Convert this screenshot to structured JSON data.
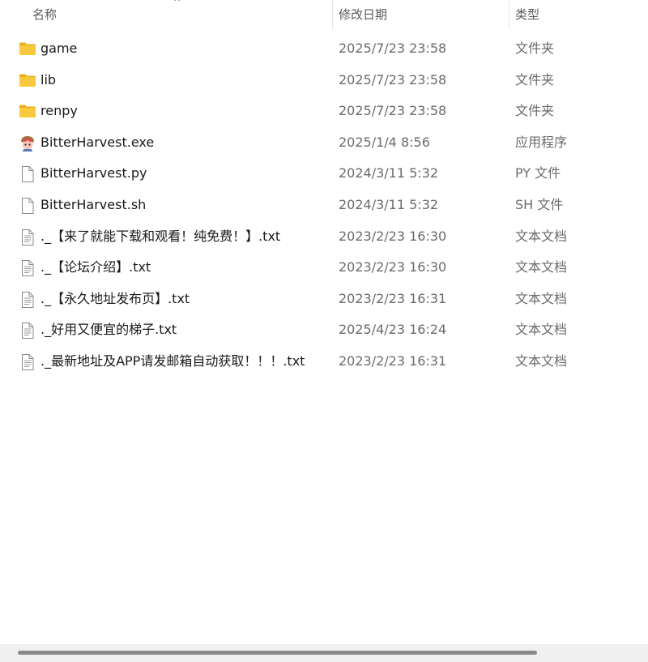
{
  "columns": {
    "name": "名称",
    "date": "修改日期",
    "type": "类型"
  },
  "sort_indicator": "^",
  "files": [
    {
      "name": "game",
      "date": "2025/7/23 23:58",
      "type": "文件夹",
      "icon": "folder-icon"
    },
    {
      "name": "lib",
      "date": "2025/7/23 23:58",
      "type": "文件夹",
      "icon": "folder-icon"
    },
    {
      "name": "renpy",
      "date": "2025/7/23 23:58",
      "type": "文件夹",
      "icon": "folder-icon"
    },
    {
      "name": "BitterHarvest.exe",
      "date": "2025/1/4 8:56",
      "type": "应用程序",
      "icon": "app-icon"
    },
    {
      "name": "BitterHarvest.py",
      "date": "2024/3/11 5:32",
      "type": "PY 文件",
      "icon": "blank-file-icon"
    },
    {
      "name": "BitterHarvest.sh",
      "date": "2024/3/11 5:32",
      "type": "SH 文件",
      "icon": "blank-file-icon"
    },
    {
      "name": "._【来了就能下载和观看！纯免费！】.txt",
      "date": "2023/2/23 16:30",
      "type": "文本文档",
      "icon": "text-file-icon"
    },
    {
      "name": "._【论坛介绍】.txt",
      "date": "2023/2/23 16:30",
      "type": "文本文档",
      "icon": "text-file-icon"
    },
    {
      "name": "._【永久地址发布页】.txt",
      "date": "2023/2/23 16:31",
      "type": "文本文档",
      "icon": "text-file-icon"
    },
    {
      "name": "._好用又便宜的梯子.txt",
      "date": "2025/4/23 16:24",
      "type": "文本文档",
      "icon": "text-file-icon"
    },
    {
      "name": "._最新地址及APP请发邮箱自动获取！！！.txt",
      "date": "2023/2/23 16:31",
      "type": "文本文档",
      "icon": "text-file-icon"
    }
  ],
  "colors": {
    "folder": "#f8c93e",
    "folder_dark": "#e8ae1c",
    "scroll_track": "#f0f0f0",
    "scroll_thumb": "#8a8a8a"
  }
}
